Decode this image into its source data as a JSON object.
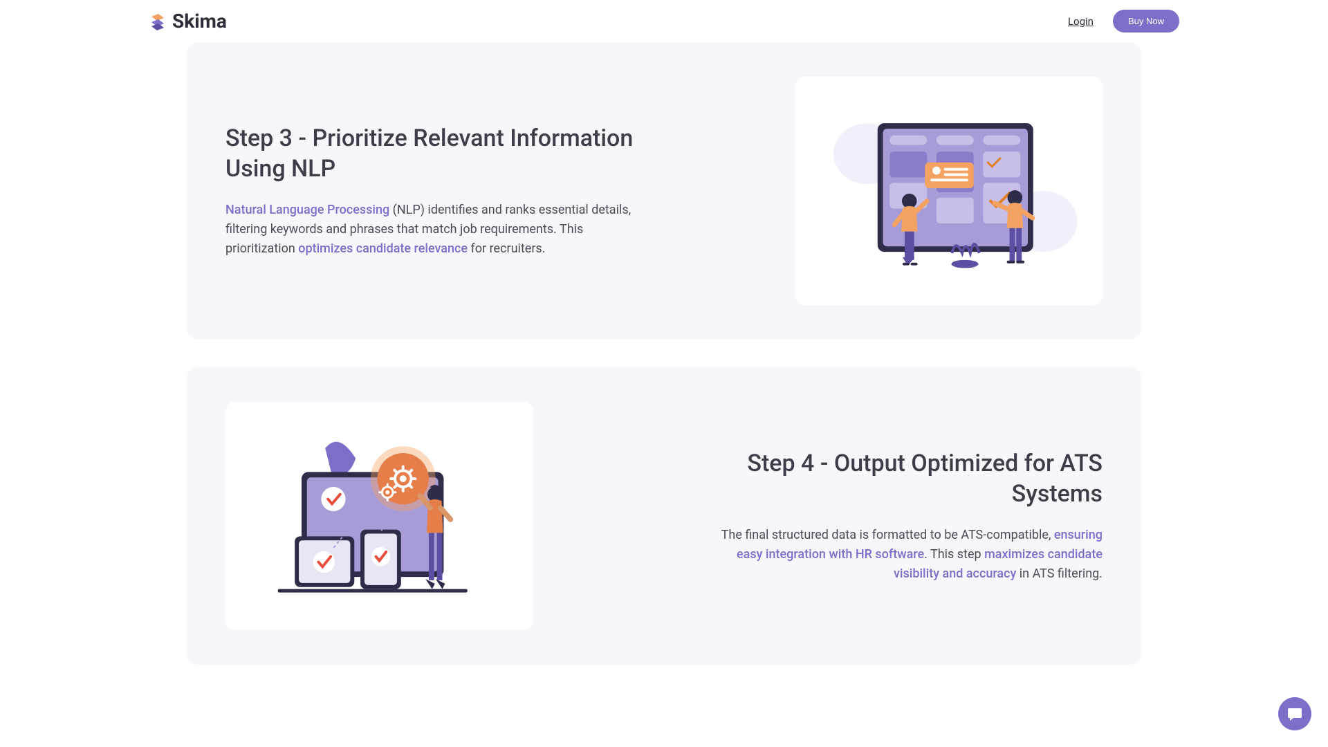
{
  "nav": {
    "brand": "Skima",
    "login": "Login",
    "buy": "Buy Now"
  },
  "step3": {
    "title": "Step 3 - Prioritize Relevant Information Using NLP",
    "link1": "Natural Language Processing",
    "text1": " (NLP) identifies and ranks essential details, filtering keywords and phrases that match job requirements. This prioritization ",
    "link2": "optimizes candidate relevance",
    "text2": " for recruiters."
  },
  "step4": {
    "title": "Step 4 - Output Optimized for ATS Systems",
    "text1": "The final structured data is formatted to be ATS-compatible, ",
    "link1": "ensuring easy integration with HR software",
    "text2": ". This step ",
    "link2": "maximizes candidate visibility and accuracy",
    "text3": " in ATS filtering."
  }
}
